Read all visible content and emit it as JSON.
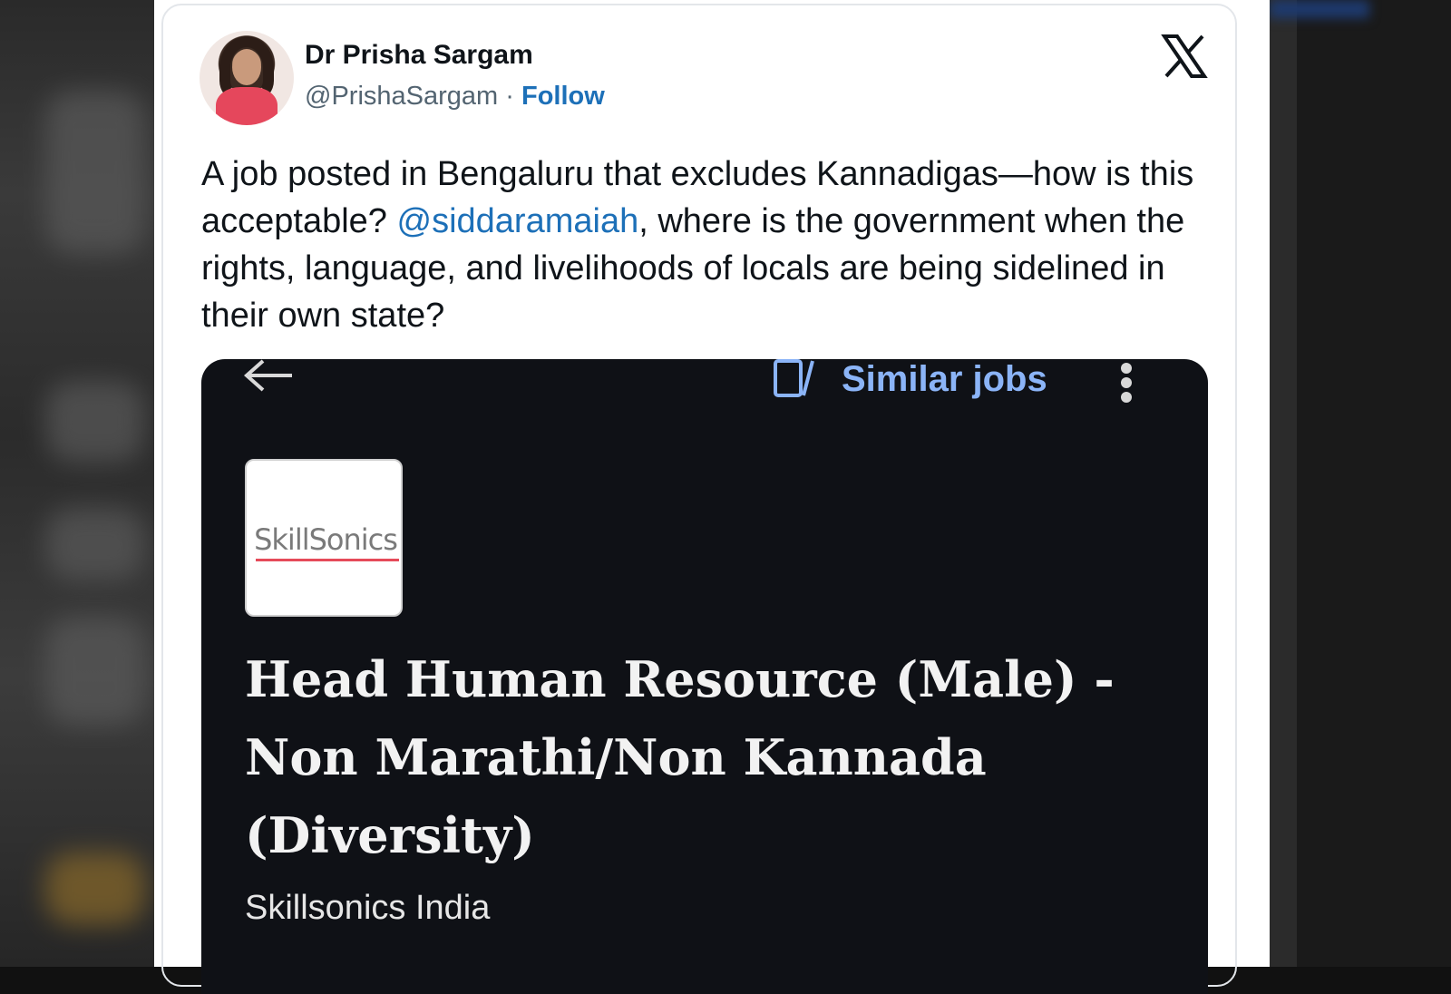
{
  "tweet": {
    "author_name": "Dr Prisha Sargam",
    "handle": "@PrishaSargam",
    "separator": "·",
    "follow_label": "Follow",
    "text_part1": "A job posted in Bengaluru that excludes Kannadigas—how is this acceptable? ",
    "mention": "@siddaramaiah",
    "text_part2": ", where is the government when the rights, language, and livelihoods of locals are being sidelined in their own state?"
  },
  "embed": {
    "similar_jobs_label": "Similar jobs",
    "company_logo_text": "SkillSonics",
    "job_title": "Head Human Resource (Male) - Non Marathi/Non Kannada (Diversity)",
    "company_name": "Skillsonics India"
  },
  "icons": [
    "x-logo-icon",
    "back-arrow-icon",
    "similar-jobs-icon",
    "more-options-icon"
  ],
  "colors": {
    "link": "#1d70b8",
    "embed_bg": "#0f1116",
    "similar_jobs": "#8bb4f7"
  }
}
